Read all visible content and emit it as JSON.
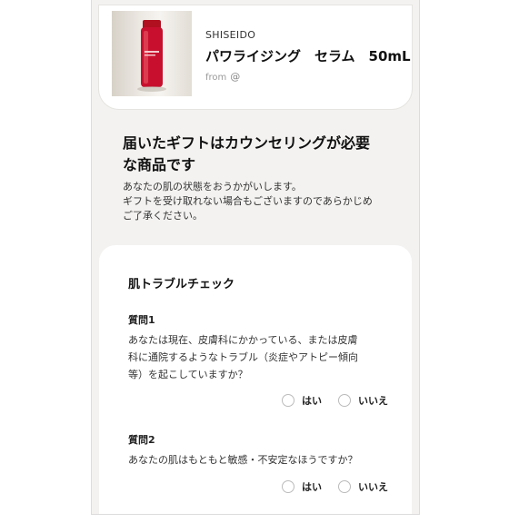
{
  "product": {
    "brand": "SHISEIDO",
    "name": "パワライジング　セラム　50mL",
    "from_label": "from",
    "from_at": "@"
  },
  "notice": {
    "heading_line1": "届いたギフトはカウンセリングが必要",
    "heading_line2": "な商品です",
    "desc_lines": [
      "あなたの肌の状態をおうかがいします。",
      "ギフトを受け取れない場合もございますのであらかじめ",
      "ご了承ください。"
    ]
  },
  "check": {
    "title": "肌トラブルチェック",
    "questions": [
      {
        "label": "質問1",
        "text_lines": [
          "あなたは現在、皮膚科にかかっている、または皮膚",
          "科に通院するようなトラブル（炎症やアトピー傾向",
          "等）を起こしていますか？"
        ],
        "options": [
          "はい",
          "いいえ"
        ]
      },
      {
        "label": "質問2",
        "text_lines": [
          "あなたの肌はもともと敏感・不安定なほうですか？"
        ],
        "options": [
          "はい",
          "いいえ"
        ]
      }
    ]
  }
}
